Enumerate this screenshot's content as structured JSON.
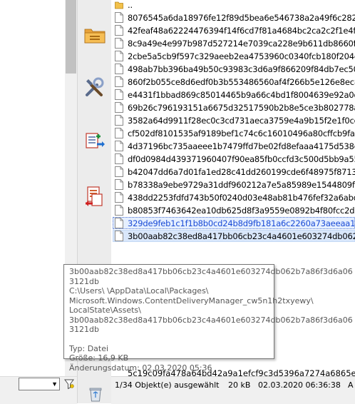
{
  "file_list": {
    "parent_label": "..",
    "files": [
      "8076545a6da18976fe12f89d5bea6e546738a2a49f6c2821",
      "42feaf48a62224476394f14f6cd7f81a4684bc2ca2c2f1e4fc",
      "8c9a49e4e997b987d527214e7039ca228e9b611db8660f9",
      "2cbe5a5cb9f597c329aeeb2ea4753960c0340fcb180f204c",
      "498ab7bb396ba49b50c93983c3d6a9f866209f84db7ec509",
      "860f2b055ce8d6edf0b3b553486560af4f266b5e126e8ec8",
      "e4431f1bbad869c85014465b9a66c4bd1f8004639e92a0d",
      "69b26c796193151a6675d32517590b2b8e5ce3b802778acc",
      "3582a64d9911f28ec0c3cd731aeca3759e4a9b15f2e1f0cc",
      "cf502df8101535af9189bef1c74c6c16010496a80cffcb9fa9",
      "4d37196bc735aaeee1b7479ffd7be02fd8efaaa4175d538e",
      "df0d0984d439371960407f90ea85fb0ccfd3c500d5bb9a55",
      "b42047dd6a7d01fa1ed28c41dd260199cde6f48975f87130",
      "b78338a9ebe9729a31ddf960212a7e5a85989e1544809f7",
      "438dd2253fdfd743b50f0240d03e48ab81b476fef32a6abd",
      "b80853f7463642ea10db625d8f3a9559e0892b4f80fcc2d6",
      "329de9feb1c1f1b8b0cd24b8d9fb181a6c2260a73aeeaa1a",
      "3b00aab82c38ed8a417bb06cb23c4a4601e603274db062b"
    ],
    "partial_last": "5c19c09fa478a64bd42a9a1efcf9c3d5396a7274a6865e09"
  },
  "tooltip": {
    "name_line1": "3b00aab82c38ed8a417bb06cb23c4a4601e603274db062b7a86f3d6a06",
    "name_line2": "3121db",
    "path_line1": "C:\\Users\\      \\AppData\\Local\\Packages\\",
    "path_line2": "Microsoft.Windows.ContentDeliveryManager_cw5n1h2txyewy\\",
    "path_line3": "LocalState\\Assets\\",
    "path_line4": "3b00aab82c38ed8a417bb06cb23c4a4601e603274db062b7a86f3d6a06",
    "path_line5": "3121db",
    "type": "Typ: Datei",
    "size": "Größe: 16,9 KB",
    "modified": "Änderungsdatum: 02.03.2020 05:36"
  },
  "status_bar": {
    "selection": "1/34 Objekt(e) ausgewählt",
    "size": "20 kB",
    "datetime": "02.03.2020 06:36:38",
    "attr": "A"
  },
  "toolbar": {
    "icons": [
      "folder-icon",
      "tools-icon",
      "copy-to-icon",
      "move-to-icon",
      "recycle-bin-icon"
    ]
  },
  "colors": {
    "selection_bg": "#d9e7fb",
    "focus_text": "#1a4bd6",
    "toolbar_bg": "#ececec",
    "status_bg": "#f0f0f0"
  }
}
